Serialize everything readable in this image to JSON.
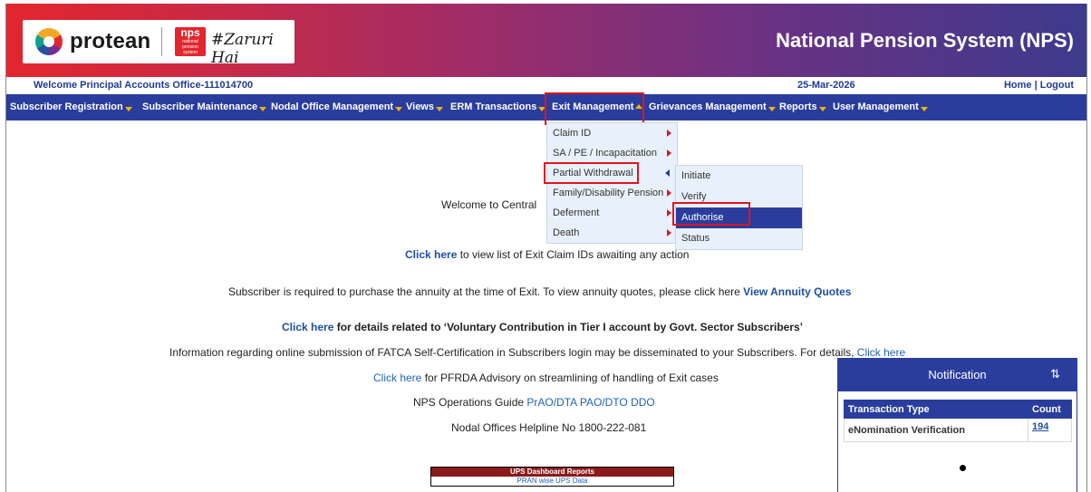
{
  "header": {
    "brand": "protean",
    "nps_badge": "nps",
    "nps_badge_sub": "national pension system",
    "tagline": "#Zaruri Hai",
    "title": "National Pension System (NPS)"
  },
  "welcome_bar": {
    "welcome": "Welcome Principal Accounts Office-111014700",
    "date": "25-Mar-2026",
    "home_logout": "Home | Logout"
  },
  "nav": {
    "items": [
      {
        "label": "Subscriber Registration"
      },
      {
        "label": "Subscriber Maintenance"
      },
      {
        "label": "Nodal Office Management"
      },
      {
        "label": "Views"
      },
      {
        "label": "ERM Transactions"
      },
      {
        "label": "Exit Management"
      },
      {
        "label": "Grievances Management"
      },
      {
        "label": "Reports"
      },
      {
        "label": "User Management"
      }
    ]
  },
  "exit_menu": {
    "items": [
      {
        "label": "Claim ID"
      },
      {
        "label": "SA / PE / Incapacitation"
      },
      {
        "label": "Partial Withdrawal"
      },
      {
        "label": "Family/Disability Pension"
      },
      {
        "label": "Deferment"
      },
      {
        "label": "Death"
      }
    ],
    "submenu": [
      {
        "label": "Initiate"
      },
      {
        "label": "Verify"
      },
      {
        "label": "Authorise"
      },
      {
        "label": "Status"
      }
    ]
  },
  "content": {
    "welcome_central": "Welcome to Central",
    "line1_link": "Click here",
    "line1_text": " to view list of Exit Claim IDs awaiting any action",
    "line2_text": "Subscriber is required to purchase the annuity at the time of Exit. To view annuity quotes, please click here ",
    "line2_link": "View Annuity Quotes",
    "line3_link": "Click here",
    "line3_text": " for details related to ‘Voluntary Contribution in Tier I account by Govt. Sector Subscribers’",
    "line4_text": "Information regarding online submission of FATCA Self-Certification in Subscribers login may be disseminated to your Subscribers. For details, ",
    "line4_link": "Click here",
    "line5_link": "Click here",
    "line5_text": " for PFRDA Advisory on streamlining of handling of Exit cases",
    "line6_text": "NPS Operations Guide ",
    "line6_link": "PrAO/DTA PAO/DTO DDO",
    "line7_text": "Nodal Offices Helpline No 1800-222-081",
    "ups_header": "UPS Dashboard Reports",
    "ups_link": "PRAN wise UPS Data"
  },
  "notification": {
    "title": "Notification",
    "sort_icon": "sort-icon",
    "columns": [
      "Transaction Type",
      "Count"
    ],
    "rows": [
      {
        "type": "eNomination Verification",
        "count": "194"
      }
    ]
  }
}
